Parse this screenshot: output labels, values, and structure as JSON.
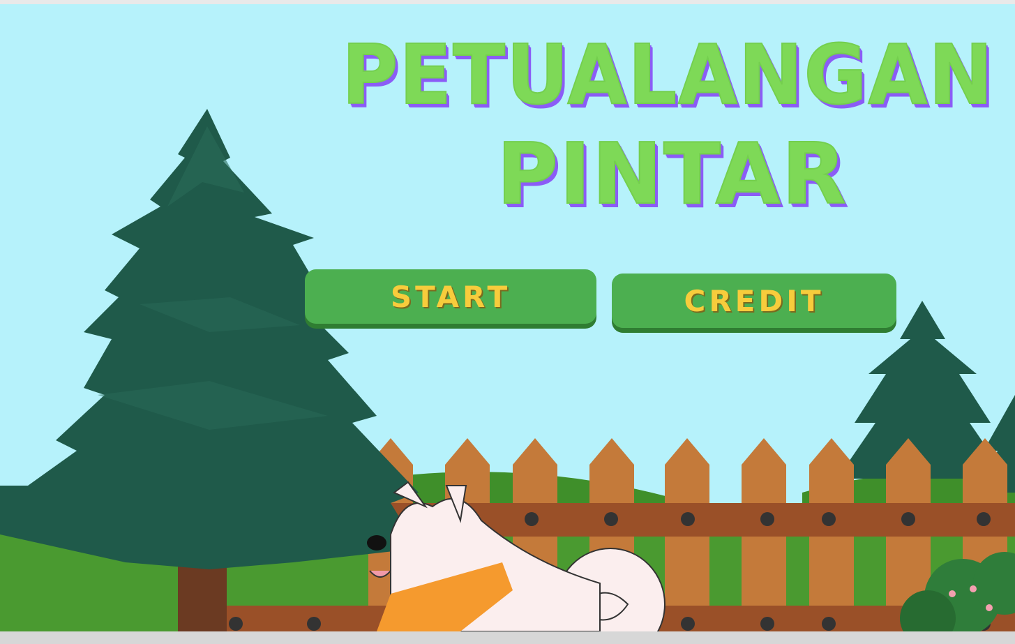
{
  "game": {
    "title_line_1": "PETUALANGAN",
    "title_line_2": "PINTAR"
  },
  "menu": {
    "start_label": "START",
    "credit_label": "CREDIT"
  },
  "colors": {
    "sky": "#b6f2fb",
    "title_fill": "#7ed957",
    "title_shadow": "#8b5cf6",
    "button_bg": "#4caf50",
    "button_text": "#f7cc3c",
    "tree": "#1f5a4a",
    "fence": "#c47a3a",
    "fence_rail": "#9a5028",
    "grass": "#3f8f2a"
  },
  "icons": [
    "pine-tree-icon",
    "fence-icon",
    "dog-icon",
    "bush-icon"
  ]
}
